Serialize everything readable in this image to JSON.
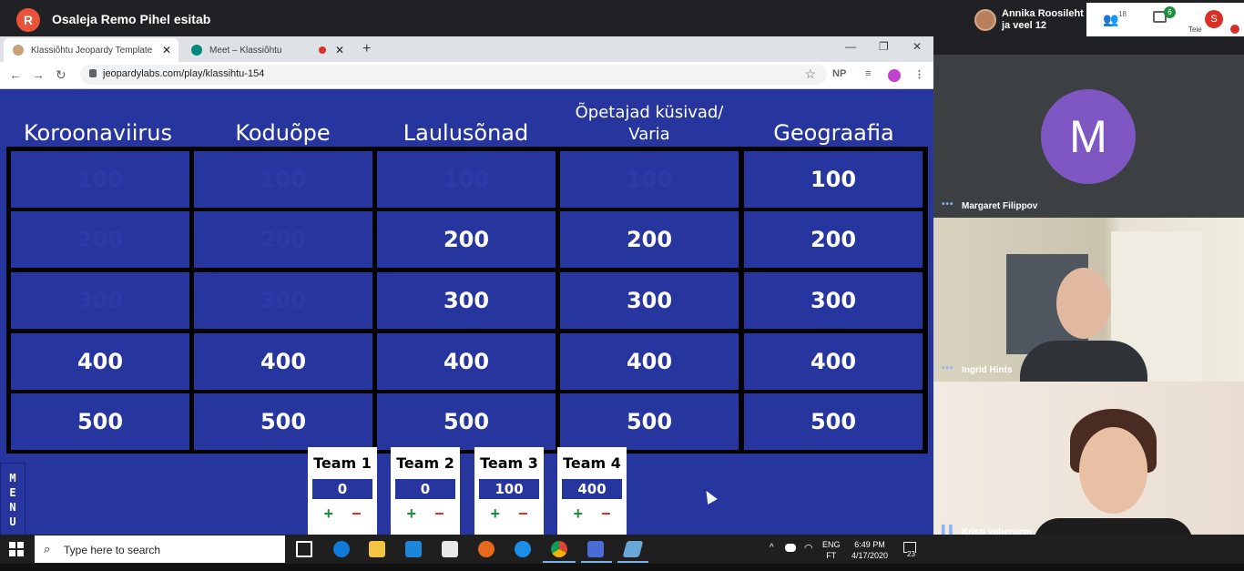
{
  "meet": {
    "presenter_initial": "R",
    "presenter_title": "Osaleja Remo Pihel esitab",
    "pinned_line1": "Annika Roosileht",
    "pinned_line2": "ja veel 12",
    "people_count": "18",
    "chat_badge": "6",
    "self_initial": "S",
    "self_label": "Teie"
  },
  "browser": {
    "tabs": [
      {
        "title": "Klassiõhtu Jeopardy Template",
        "active": true
      },
      {
        "title": "Meet – Klassiõhtu",
        "active": false
      }
    ],
    "url": "jeopardylabs.com/play/klassihtu-154",
    "ext_label": "NP"
  },
  "board": {
    "categories": [
      "Koroonaviirus",
      "Koduõpe",
      "Laulusõnad",
      "Õpetajad küsivad/ Varia",
      "Geograafia"
    ],
    "values": [
      "100",
      "200",
      "300",
      "400",
      "500"
    ],
    "used": [
      [
        true,
        true,
        true,
        true,
        false
      ],
      [
        true,
        true,
        false,
        false,
        false
      ],
      [
        true,
        true,
        false,
        false,
        false
      ],
      [
        false,
        false,
        false,
        false,
        false
      ],
      [
        false,
        false,
        false,
        false,
        false
      ]
    ],
    "menu_letters": [
      "M",
      "E",
      "N",
      "U"
    ],
    "plus": "+",
    "minus": "−",
    "teams": [
      {
        "name": "Team 1",
        "score": "0"
      },
      {
        "name": "Team 2",
        "score": "0"
      },
      {
        "name": "Team 3",
        "score": "100"
      },
      {
        "name": "Team 4",
        "score": "400"
      }
    ]
  },
  "participants": [
    {
      "name": "Margaret Filippov",
      "initial": "M"
    },
    {
      "name": "Ingrid Hints"
    },
    {
      "name": "Kristi Vahenurm"
    }
  ],
  "taskbar": {
    "search_placeholder": "Type here to search",
    "lang1": "ENG",
    "lang2": "FT",
    "time": "6:49 PM",
    "date": "4/17/2020",
    "notif_count": "23"
  }
}
